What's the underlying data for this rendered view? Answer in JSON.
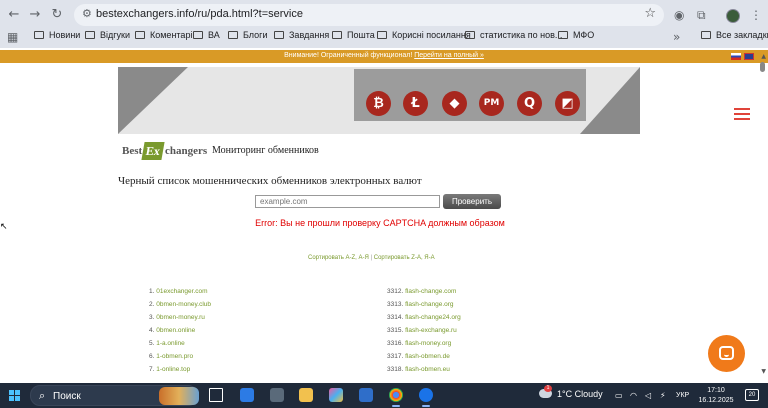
{
  "browser": {
    "url": "bestexchangers.info/ru/pda.html?t=service",
    "bookmarks": [
      {
        "label": "Новини"
      },
      {
        "label": "Відгуки"
      },
      {
        "label": "Коментарі"
      },
      {
        "label": "ВА"
      },
      {
        "label": "Блоги"
      },
      {
        "label": "Завдання"
      },
      {
        "label": "Пошта"
      },
      {
        "label": "Корисні посилання"
      },
      {
        "label": "статистика по нов..."
      },
      {
        "label": "МФО"
      }
    ],
    "all_bookmarks": "Все закладки"
  },
  "warning": {
    "text": "Внимание! Ограниченный функционал!",
    "link": "Перейти на полный »"
  },
  "site": {
    "logo_best": "Best",
    "logo_ex": "Ex",
    "logo_changers": "changers",
    "subtitle": "Мониторинг обменников",
    "coins": [
      "₿",
      "Ł",
      "◆",
      "PM",
      "Q",
      "◩"
    ]
  },
  "main": {
    "heading": "Черный список мошеннических обменников электронных валют",
    "input_placeholder": "example.com",
    "check_button": "Проверить",
    "error": "Error: Вы не прошли проверку CAPTCHA должным образом",
    "sort_az": "Сортировать A-Z, А-Я",
    "sort_sep": "|",
    "sort_za": "Сортировать Z-A, Я-А"
  },
  "left_list": [
    {
      "num": "1.",
      "name": "01exchanger.com"
    },
    {
      "num": "2.",
      "name": "0bmen-money.club"
    },
    {
      "num": "3.",
      "name": "0bmen-money.ru"
    },
    {
      "num": "4.",
      "name": "0bmen.online"
    },
    {
      "num": "5.",
      "name": "1-a.online"
    },
    {
      "num": "6.",
      "name": "1-obmen.pro"
    },
    {
      "num": "7.",
      "name": "1-online.top"
    }
  ],
  "right_list": [
    {
      "num": "3312.",
      "name": "flash-change.com"
    },
    {
      "num": "3313.",
      "name": "flash-change.org"
    },
    {
      "num": "3314.",
      "name": "flash-change24.org"
    },
    {
      "num": "3315.",
      "name": "flash-exchange.ru"
    },
    {
      "num": "3316.",
      "name": "flash-money.org"
    },
    {
      "num": "3317.",
      "name": "flash-obmen.de"
    },
    {
      "num": "3318.",
      "name": "flash-obmen.eu"
    }
  ],
  "taskbar": {
    "search_label": "Поиск",
    "weather": "1°C  Cloudy",
    "weather_badge": "1",
    "lang": "УКР",
    "time": "17:10",
    "date": "16.12.2025",
    "notifications": "20"
  },
  "colors": {
    "accent_green": "#7a9a2e",
    "warning_orange": "#d99a26",
    "error_red": "#e00000",
    "chat_orange": "#f07a1a"
  }
}
